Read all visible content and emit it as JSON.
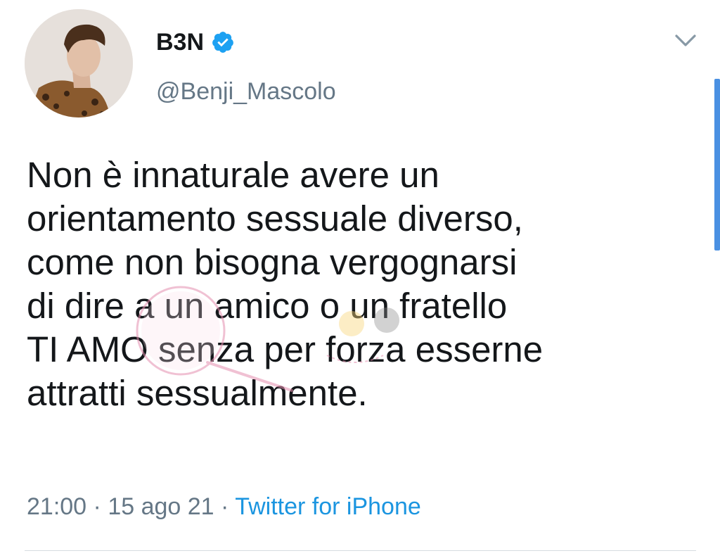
{
  "user": {
    "display_name": "B3N",
    "handle": "@Benji_Mascolo",
    "verified": true,
    "avatar_icon": "profile-photo"
  },
  "tweet": {
    "lines": [
      "Non è innaturale avere un",
      "orientamento sessuale diverso,",
      "come non bisogna vergognarsi",
      "di dire a un amico o un fratello",
      "TI AMO senza per forza esserne",
      "attratti sessualmente."
    ],
    "time": "21:00",
    "date": "15 ago 21",
    "separator": "·",
    "source": "Twitter for iPhone"
  },
  "colors": {
    "text": "#14171a",
    "secondary": "#657786",
    "link": "#1b95e0",
    "verified": "#1da1f2"
  },
  "icons": {
    "verified": "verified-badge-icon",
    "menu": "chevron-down-icon"
  }
}
